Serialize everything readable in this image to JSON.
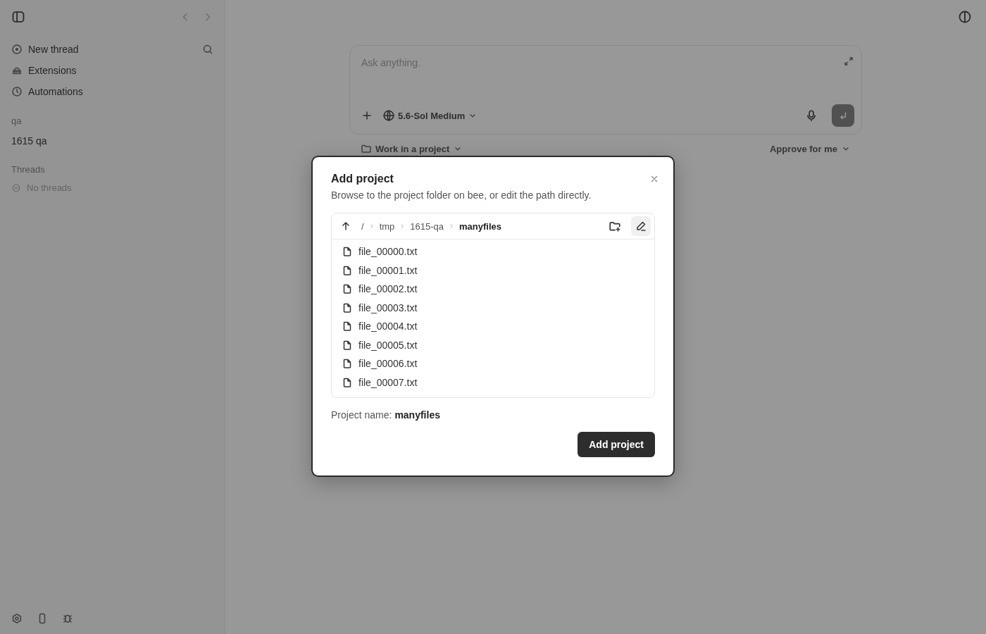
{
  "sidebar": {
    "nav": [
      {
        "label": "New thread",
        "kind": "new"
      },
      {
        "label": "Extensions",
        "kind": "ext"
      },
      {
        "label": "Automations",
        "kind": "clock"
      }
    ],
    "project_group": "qa",
    "projects": [
      {
        "label": "1615 qa"
      }
    ],
    "threads_heading": "Threads",
    "threads_empty": "No threads"
  },
  "composer": {
    "placeholder": "Ask anything.",
    "model": "5.6-Sol Medium",
    "project_picker": "Work in a project",
    "approval": "Approve for me"
  },
  "dialog": {
    "title": "Add project",
    "subtitle": "Browse to the project folder on bee, or edit the path directly.",
    "path": [
      {
        "label": "/",
        "current": false
      },
      {
        "label": "tmp",
        "current": false
      },
      {
        "label": "1615-qa",
        "current": false
      },
      {
        "label": "manyfiles",
        "current": true
      }
    ],
    "edit_path_active": true,
    "files": [
      "file_00000.txt",
      "file_00001.txt",
      "file_00002.txt",
      "file_00003.txt",
      "file_00004.txt",
      "file_00005.txt",
      "file_00006.txt",
      "file_00007.txt"
    ],
    "name_label": "Project name:",
    "name_value": "manyfiles",
    "submit": "Add project"
  }
}
